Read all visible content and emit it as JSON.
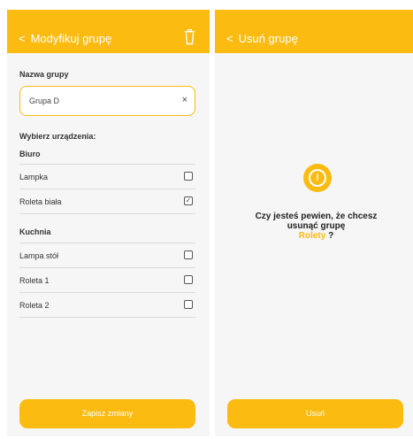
{
  "edit_screen": {
    "header_title": "Modyfikuj grupę",
    "group_name_label": "Nazwa grupy",
    "group_name_value": "Grupa D",
    "clear_symbol": "×",
    "devices_label": "Wybierz urządzenia:",
    "rooms": [
      {
        "name": "Biuro",
        "devices": [
          {
            "label": "Lampka",
            "checked": false
          },
          {
            "label": "Roleta biała",
            "checked": true
          }
        ]
      },
      {
        "name": "Kuchnia",
        "devices": [
          {
            "label": "Lampa stół",
            "checked": false
          },
          {
            "label": "Roleta 1",
            "checked": false
          },
          {
            "label": "Roleta 2",
            "checked": false
          }
        ]
      }
    ],
    "save_button": "Zapisz zmiany"
  },
  "delete_screen": {
    "header_title": "Usuń grupę",
    "question_line1": "Czy jesteś pewien, że chcesz",
    "question_line2": "usunąć grupę",
    "group_name": "Rolety",
    "question_mark": "?",
    "delete_button": "Usuń"
  },
  "colors": {
    "accent": "#fbbb11",
    "background": "#f6f6f6",
    "text": "#333333"
  }
}
